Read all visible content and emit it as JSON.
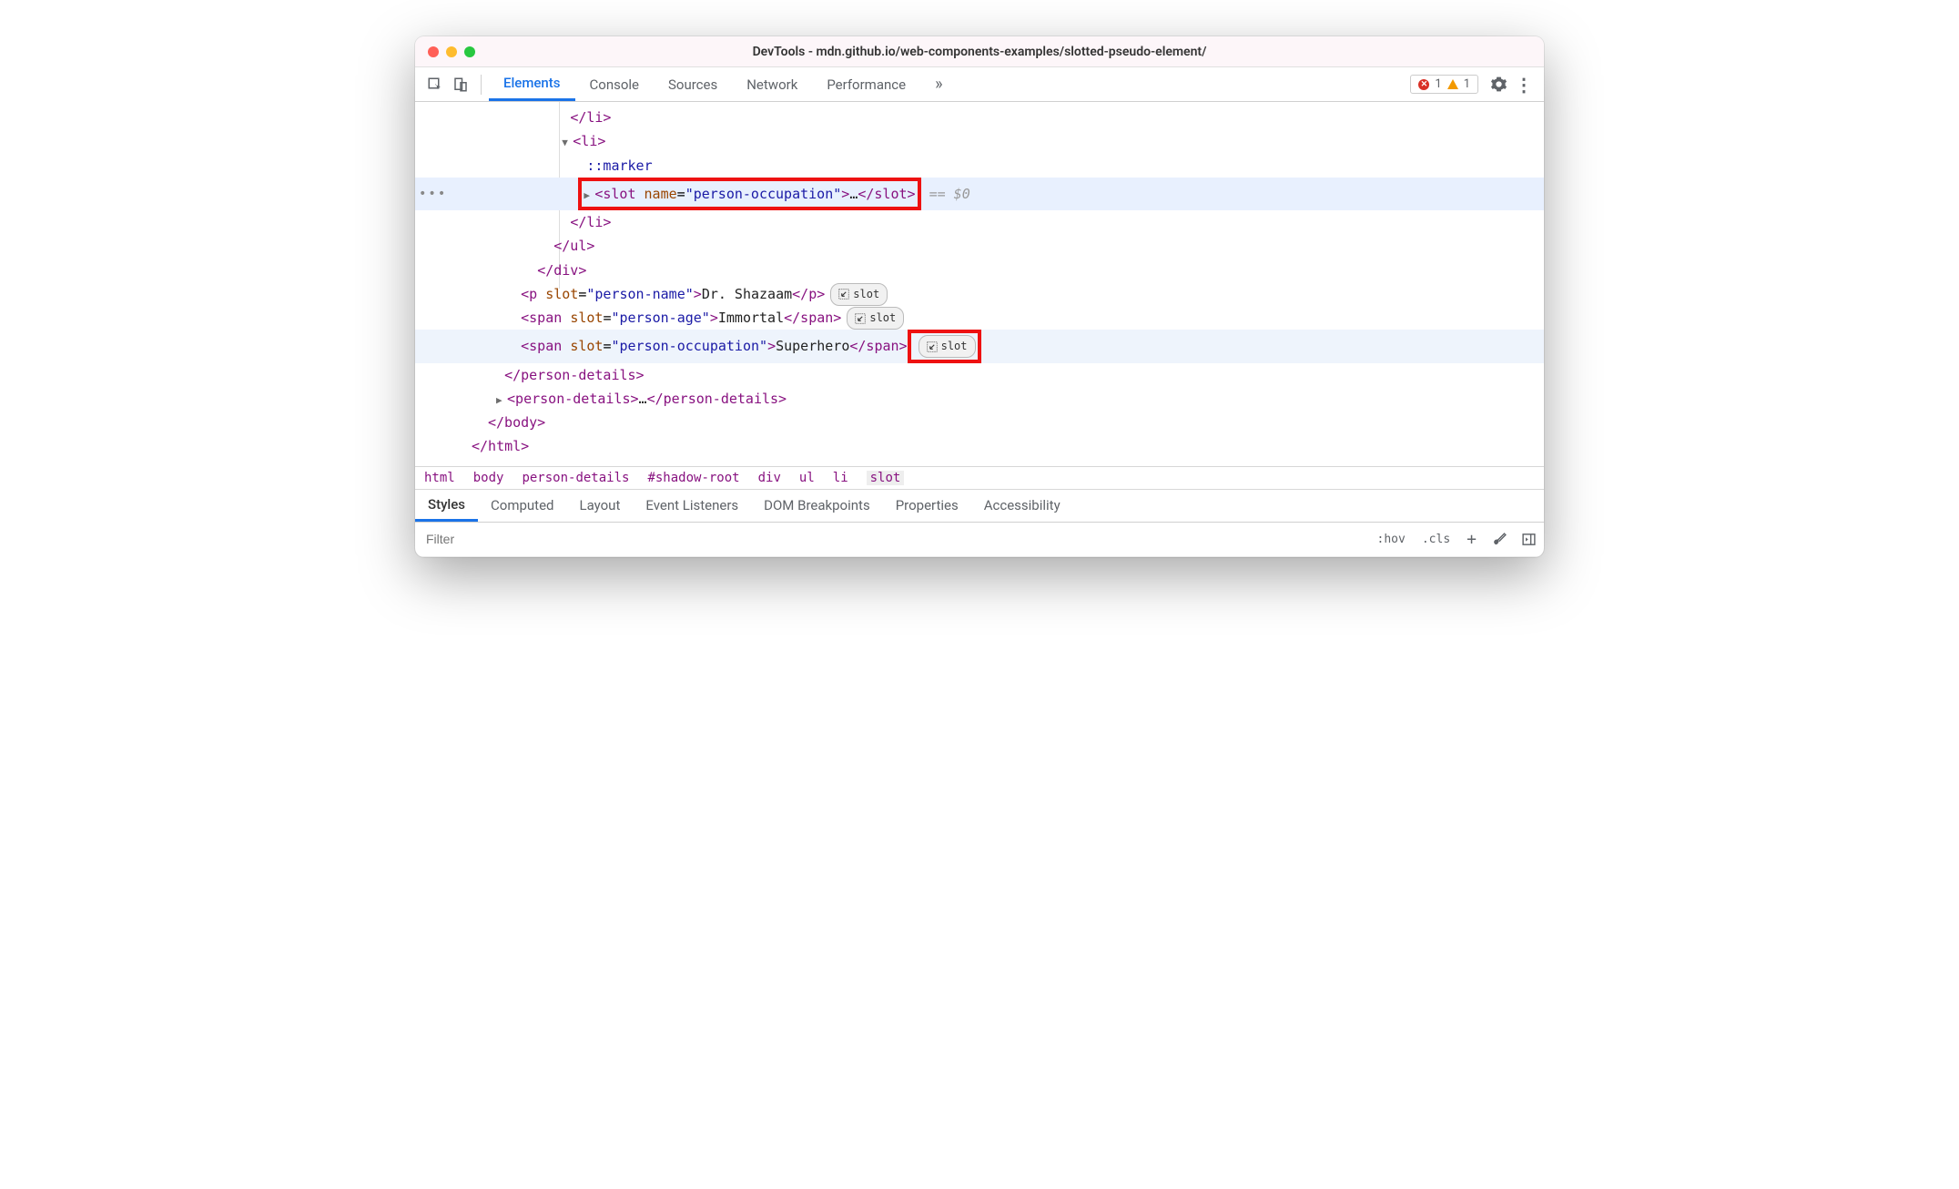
{
  "window": {
    "title": "DevTools - mdn.github.io/web-components-examples/slotted-pseudo-element/"
  },
  "toolbar": {
    "tabs": [
      "Elements",
      "Console",
      "Sources",
      "Network",
      "Performance"
    ],
    "active": "Elements",
    "errors": "1",
    "warnings": "1"
  },
  "tree": {
    "close_li": "</li>",
    "open_li": "<li>",
    "marker": "::marker",
    "slot_open": "<slot",
    "slot_attr_name": "name",
    "slot_attr_val": "\"person-occupation\"",
    "slot_mid": ">",
    "slot_ellipsis": "…",
    "slot_close": "</slot>",
    "eq0": " == $0",
    "close_li2": "</li>",
    "close_ul": "</ul>",
    "close_div": "</div>",
    "p_open": "<p",
    "p_slot_name": "slot",
    "p_slot_val": "\"person-name\"",
    "p_text": "Dr. Shazaam",
    "p_close": "</p>",
    "span1_open": "<span",
    "span1_slot_val": "\"person-age\"",
    "span1_text": "Immortal",
    "span1_close": "</span>",
    "span2_open": "<span",
    "span2_slot_val": "\"person-occupation\"",
    "span2_text": "Superhero",
    "span2_close": "</span>",
    "close_person": "</person-details>",
    "person2_open": "<person-details>",
    "person2_ellipsis": "…",
    "person2_close": "</person-details>",
    "close_body": "</body>",
    "close_html": "</html>",
    "slot_badge": "slot"
  },
  "breadcrumb": [
    "html",
    "body",
    "person-details",
    "#shadow-root",
    "div",
    "ul",
    "li",
    "slot"
  ],
  "breadcrumb_selected": "slot",
  "subtabs": [
    "Styles",
    "Computed",
    "Layout",
    "Event Listeners",
    "DOM Breakpoints",
    "Properties",
    "Accessibility"
  ],
  "subtab_active": "Styles",
  "stylesbar": {
    "filter_placeholder": "Filter",
    "hov": ":hov",
    "cls": ".cls"
  }
}
